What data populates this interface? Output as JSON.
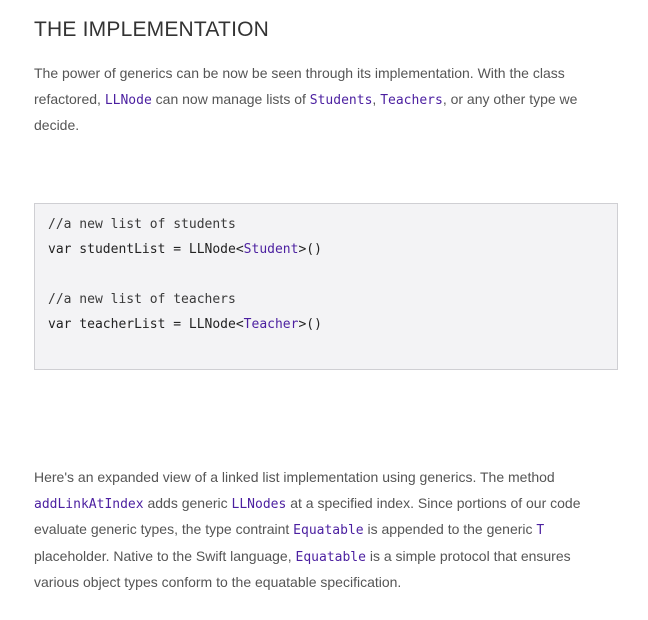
{
  "heading": "THE IMPLEMENTATION",
  "paragraph1": {
    "t1": "The power of generics can be now be seen through its implementation. With the class refactored, ",
    "c1": "LLNode",
    "t2": " can now manage lists of ",
    "c2": "Students",
    "t3": ", ",
    "c3": "Teachers",
    "t4": ", or any other type we decide."
  },
  "code_block": {
    "comment1": "//a new list of students",
    "line1_prefix": "var studentList = LLNode<",
    "line1_type": "Student",
    "line1_suffix": ">()",
    "comment2": "//a new list of teachers",
    "line2_prefix": "var teacherList = LLNode<",
    "line2_type": "Teacher",
    "line2_suffix": ">()"
  },
  "paragraph2": {
    "t1": "Here's an expanded view of a linked list implementation using generics. The method ",
    "c1": "addLinkAtIndex",
    "t2": " adds generic ",
    "c2": "LLNodes",
    "t3": " at a specified index. Since portions of our code evaluate generic types, the type contraint ",
    "c3": "Equatable",
    "t4": " is appended to the generic ",
    "c4": "T",
    "t5": " placeholder. Native to the Swift language, ",
    "c5": "Equatable",
    "t6": " is a simple protocol that ensures various object types conform to the equatable specification."
  }
}
